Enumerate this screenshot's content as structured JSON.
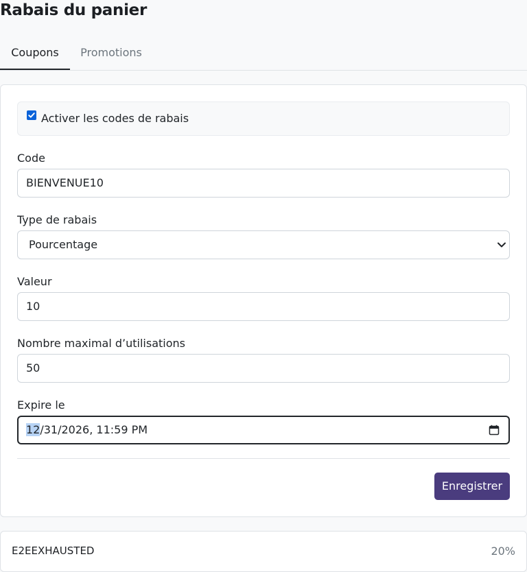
{
  "page": {
    "title": "Rabais du panier"
  },
  "tabs": [
    {
      "label": "Coupons",
      "active": true
    },
    {
      "label": "Promotions",
      "active": false
    }
  ],
  "form": {
    "enable_label": "Activer les codes de rabais",
    "enable_checked": true,
    "code": {
      "label": "Code",
      "value": "BIENVENUE10"
    },
    "discount_type": {
      "label": "Type de rabais",
      "value": "Pourcentage"
    },
    "value": {
      "label": "Valeur",
      "value": "10"
    },
    "max_uses": {
      "label": "Nombre maximal d’utilisations",
      "value": "50"
    },
    "expires": {
      "label": "Expire le",
      "month": "12",
      "rest": "/31/2026, 11:59 PM"
    },
    "save_label": "Enregistrer"
  },
  "coupons": [
    {
      "code": "E2EEXHAUSTED",
      "value": "20%"
    }
  ],
  "colors": {
    "accent": "#4a3c7e",
    "checkbox": "#0b63d9"
  }
}
